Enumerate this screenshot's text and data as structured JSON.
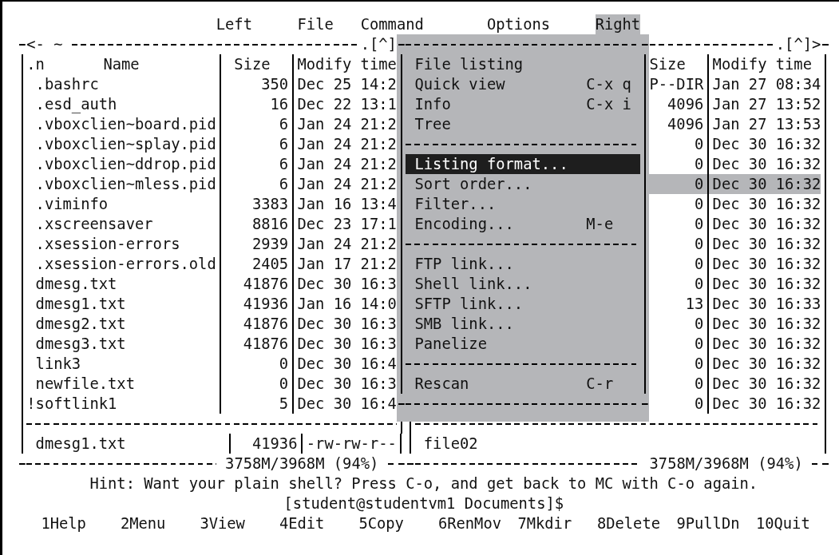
{
  "menu_bar": [
    {
      "label": "Left",
      "selected": false
    },
    {
      "label": "File",
      "selected": false
    },
    {
      "label": "Command",
      "selected": false
    },
    {
      "label": "Options",
      "selected": false
    },
    {
      "label": "Right",
      "selected": true
    }
  ],
  "left_panel": {
    "back": "<-",
    "path": "~",
    "controls": ".[^]",
    "header": {
      "sort": ".n",
      "name": "Name",
      "size": "Size",
      "time": "Modify time"
    },
    "files": [
      {
        "kind": "file",
        "name": ".bashrc",
        "size": "350",
        "time": "Dec 25 14:2"
      },
      {
        "kind": "file",
        "name": ".esd_auth",
        "size": "16",
        "time": "Dec 22 13:1"
      },
      {
        "kind": "file",
        "name": ".vboxclien~board.pid",
        "size": "6",
        "time": "Jan 24 21:2"
      },
      {
        "kind": "file",
        "name": ".vboxclien~splay.pid",
        "size": "6",
        "time": "Jan 24 21:2"
      },
      {
        "kind": "file",
        "name": ".vboxclien~ddrop.pid",
        "size": "6",
        "time": "Jan 24 21:2"
      },
      {
        "kind": "file",
        "name": ".vboxclien~mless.pid",
        "size": "6",
        "time": "Jan 24 21:2"
      },
      {
        "kind": "file",
        "name": ".viminfo",
        "size": "3383",
        "time": "Jan 16 13:4"
      },
      {
        "kind": "file",
        "name": ".xscreensaver",
        "size": "8816",
        "time": "Dec 23 17:1"
      },
      {
        "kind": "file",
        "name": ".xsession-errors",
        "size": "2939",
        "time": "Jan 24 21:2"
      },
      {
        "kind": "file",
        "name": ".xsession-errors.old",
        "size": "2405",
        "time": "Jan 17 21:2"
      },
      {
        "kind": "file",
        "name": "dmesg.txt",
        "size": "41876",
        "time": "Dec 30 16:3"
      },
      {
        "kind": "file",
        "name": "dmesg1.txt",
        "size": "41936",
        "time": "Jan 16 14:0"
      },
      {
        "kind": "file",
        "name": "dmesg2.txt",
        "size": "41876",
        "time": "Dec 30 16:3"
      },
      {
        "kind": "file",
        "name": "dmesg3.txt",
        "size": "41876",
        "time": "Dec 30 16:3"
      },
      {
        "kind": "file",
        "name": "link3",
        "size": "0",
        "time": "Dec 30 16:4"
      },
      {
        "kind": "file",
        "name": "newfile.txt",
        "size": "0",
        "time": "Dec 30 16:3"
      },
      {
        "kind": "broken-link",
        "name": "!softlink1",
        "size": "5",
        "time": "Dec 30 16:4"
      }
    ],
    "mini_status": {
      "name": "dmesg1.txt",
      "size": "41936",
      "permissions": "-rw-rw-r--"
    },
    "disk": "3758M/3968M (94%)"
  },
  "right_panel": {
    "controls": ".[^]",
    "more": ">",
    "header": {
      "size": "Size",
      "time": "Modify time"
    },
    "files": [
      {
        "size": "P--DIR",
        "time": "Jan 27 08:34",
        "selected": false
      },
      {
        "size": "4096",
        "time": "Jan 27 13:52",
        "selected": false
      },
      {
        "size": "4096",
        "time": "Jan 27 13:53",
        "selected": false
      },
      {
        "size": "0",
        "time": "Dec 30 16:32",
        "selected": false
      },
      {
        "size": "0",
        "time": "Dec 30 16:32",
        "selected": false
      },
      {
        "size": "0",
        "time": "Dec 30 16:32",
        "selected": true
      },
      {
        "size": "0",
        "time": "Dec 30 16:32",
        "selected": false
      },
      {
        "size": "0",
        "time": "Dec 30 16:32",
        "selected": false
      },
      {
        "size": "0",
        "time": "Dec 30 16:32",
        "selected": false
      },
      {
        "size": "0",
        "time": "Dec 30 16:32",
        "selected": false
      },
      {
        "size": "0",
        "time": "Dec 30 16:32",
        "selected": false
      },
      {
        "size": "13",
        "time": "Dec 30 16:33",
        "selected": false
      },
      {
        "size": "0",
        "time": "Dec 30 16:32",
        "selected": false
      },
      {
        "size": "0",
        "time": "Dec 30 16:32",
        "selected": false
      },
      {
        "size": "0",
        "time": "Dec 30 16:32",
        "selected": false
      },
      {
        "size": "0",
        "time": "Dec 30 16:32",
        "selected": false
      },
      {
        "size": "0",
        "time": "Dec 30 16:32",
        "selected": false
      }
    ],
    "mini_status": {
      "name": "file02"
    },
    "disk": "3758M/3968M (94%)"
  },
  "dropdown": {
    "items": [
      {
        "kind": "item",
        "label": "File listing",
        "selected": false
      },
      {
        "kind": "item",
        "label": "Quick view",
        "shortcut": "C-x q",
        "selected": false
      },
      {
        "kind": "item",
        "label": "Info",
        "shortcut": "C-x i",
        "selected": false
      },
      {
        "kind": "item",
        "label": "Tree",
        "selected": false
      },
      {
        "kind": "separator"
      },
      {
        "kind": "item",
        "label": "Listing format...",
        "selected": true
      },
      {
        "kind": "item",
        "label": "Sort order...",
        "selected": false
      },
      {
        "kind": "item",
        "label": "Filter...",
        "selected": false
      },
      {
        "kind": "item",
        "label": "Encoding...",
        "shortcut": "M-e",
        "selected": false
      },
      {
        "kind": "separator"
      },
      {
        "kind": "item",
        "label": "FTP link...",
        "selected": false
      },
      {
        "kind": "item",
        "label": "Shell link...",
        "selected": false
      },
      {
        "kind": "item",
        "label": "SFTP link...",
        "selected": false
      },
      {
        "kind": "item",
        "label": "SMB link...",
        "selected": false
      },
      {
        "kind": "item",
        "label": "Panelize",
        "selected": false
      },
      {
        "kind": "separator"
      },
      {
        "kind": "item",
        "label": "Rescan",
        "shortcut": "C-r",
        "selected": false
      }
    ]
  },
  "hint": "Hint: Want your plain shell? Press C-o, and get back to MC with C-o again.",
  "prompt": "[student@studentvm1 Documents]$",
  "function_keys": [
    "1Help",
    "2Menu",
    "3View",
    "4Edit",
    "5Copy",
    "6RenMov",
    "7Mkdir",
    "8Delete",
    "9PullDn",
    "10Quit"
  ]
}
